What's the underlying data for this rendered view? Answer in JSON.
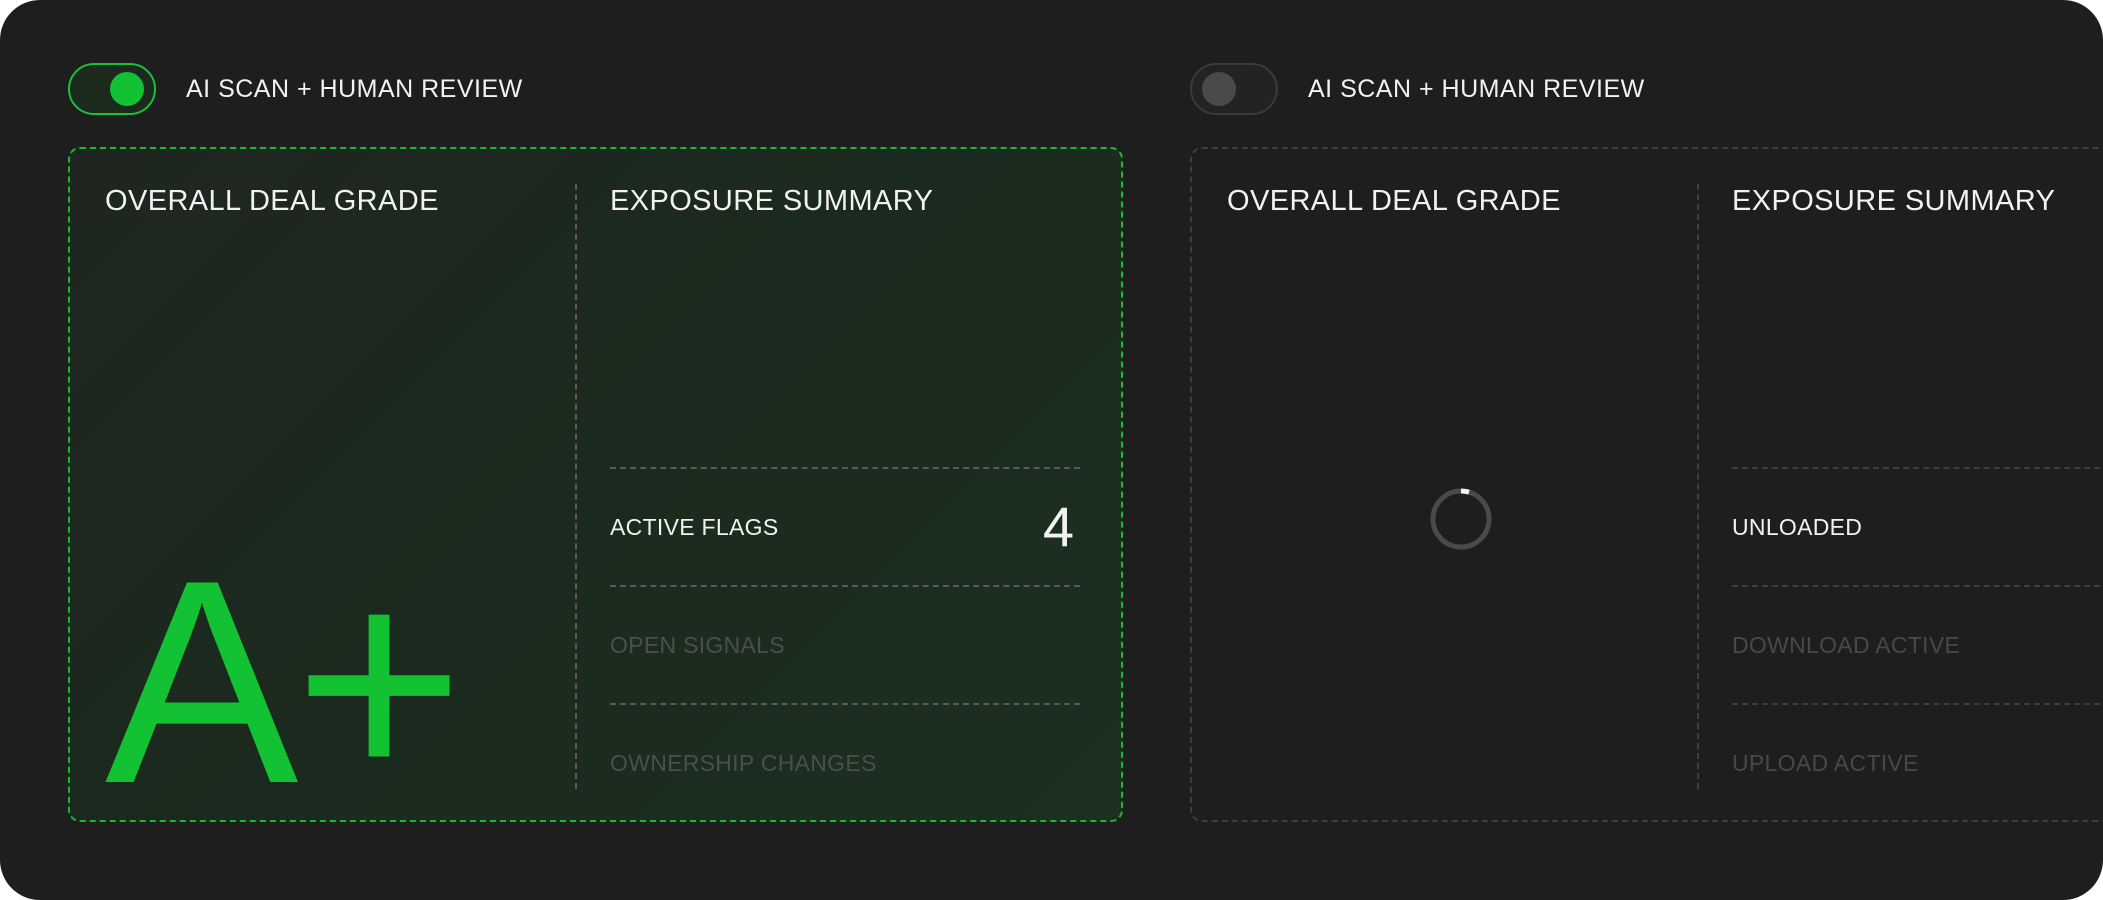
{
  "left_panel": {
    "toggle_state": "on",
    "toggle_label": "AI SCAN + HUMAN REVIEW",
    "grade_title": "OVERALL DEAL GRADE",
    "grade_value": "A+",
    "exposure_title": "EXPOSURE SUMMARY",
    "rows": [
      {
        "label": "ACTIVE FLAGS",
        "value": "4"
      },
      {
        "label": "OPEN SIGNALS",
        "value": ""
      },
      {
        "label": "OWNERSHIP CHANGES",
        "value": ""
      }
    ]
  },
  "right_panel": {
    "toggle_state": "off",
    "toggle_label": "AI SCAN + HUMAN REVIEW",
    "grade_title": "OVERALL DEAL GRADE",
    "exposure_title": "EXPOSURE SUMMARY",
    "rows": [
      {
        "label": "UNLOADED"
      },
      {
        "label": "DOWNLOAD ACTIVE"
      },
      {
        "label": "UPLOAD ACTIVE"
      }
    ]
  },
  "colors": {
    "accent_green": "#13c232",
    "background": "#1e1e1f",
    "text": "#f2f2f2",
    "muted": "#4a4a4c"
  },
  "icons": {
    "loading": "spinner-icon"
  }
}
